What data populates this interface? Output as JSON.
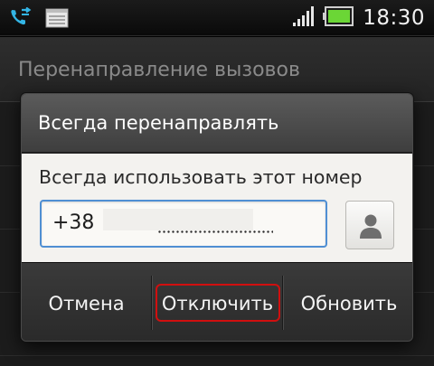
{
  "status_bar": {
    "time": "18:30",
    "left_icons": [
      "call-forward-icon",
      "notes-icon"
    ],
    "right_icons": [
      "signal-icon",
      "battery-icon"
    ]
  },
  "background": {
    "title": "Перенаправление вызовов"
  },
  "dialog": {
    "title": "Всегда перенаправлять",
    "label": "Всегда использовать этот номер",
    "number_value": "+38",
    "contact_icon": "contact-person-icon",
    "buttons": {
      "cancel": "Отмена",
      "disable": "Отключить",
      "update": "Обновить"
    },
    "highlight_color": "#d10f0f",
    "field_focus_color": "#4f8fd3"
  }
}
